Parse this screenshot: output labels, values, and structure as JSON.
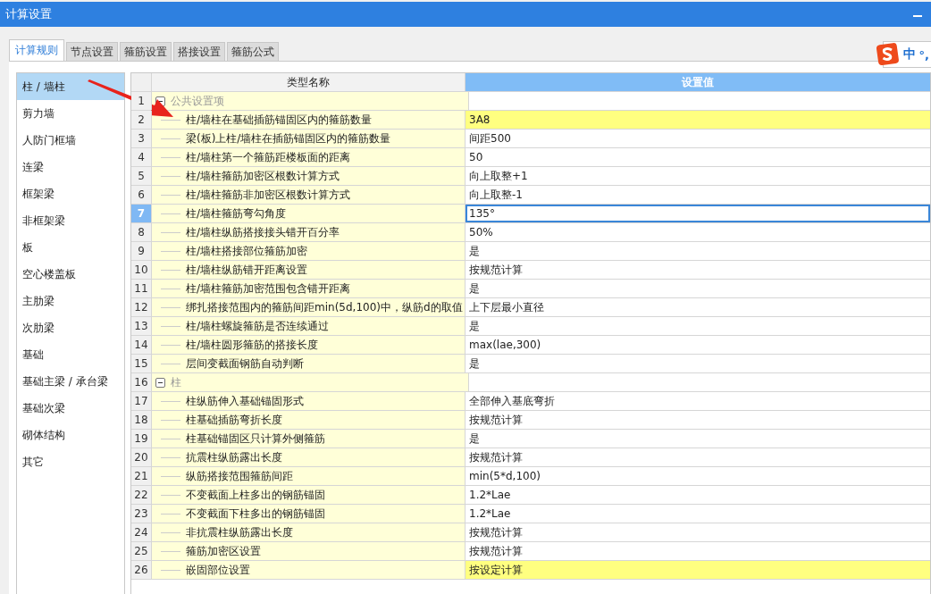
{
  "window": {
    "title": "计算设置"
  },
  "ime": {
    "mode": "中",
    "punctuation": "°,"
  },
  "tabs": [
    {
      "label": "计算规则",
      "selected": true
    },
    {
      "label": "节点设置",
      "selected": false
    },
    {
      "label": "箍筋设置",
      "selected": false
    },
    {
      "label": "搭接设置",
      "selected": false
    },
    {
      "label": "箍筋公式",
      "selected": false
    }
  ],
  "sidebar": {
    "items": [
      {
        "label": "柱 / 墙柱",
        "selected": true
      },
      {
        "label": "剪力墙",
        "selected": false
      },
      {
        "label": "人防门框墙",
        "selected": false
      },
      {
        "label": "连梁",
        "selected": false
      },
      {
        "label": "框架梁",
        "selected": false
      },
      {
        "label": "非框架梁",
        "selected": false
      },
      {
        "label": "板",
        "selected": false
      },
      {
        "label": "空心楼盖板",
        "selected": false
      },
      {
        "label": "主肋梁",
        "selected": false
      },
      {
        "label": "次肋梁",
        "selected": false
      },
      {
        "label": "基础",
        "selected": false
      },
      {
        "label": "基础主梁 / 承台梁",
        "selected": false
      },
      {
        "label": "基础次梁",
        "selected": false
      },
      {
        "label": "砌体结构",
        "selected": false
      },
      {
        "label": "其它",
        "selected": false
      }
    ]
  },
  "table": {
    "columns": [
      "类型名称",
      "设置值"
    ],
    "rows": [
      {
        "kind": "group",
        "number": "1",
        "name": "公共设置项",
        "expanded": true,
        "selected": false
      },
      {
        "kind": "setting",
        "number": "2",
        "name": "柱/墙柱在基础插筋锚固区内的箍筋数量",
        "value": "3A8",
        "highlighted": true,
        "selected": false
      },
      {
        "kind": "setting",
        "number": "3",
        "name": "梁(板)上柱/墙柱在插筋锚固区内的箍筋数量",
        "value": "间距500",
        "highlighted": false,
        "selected": false
      },
      {
        "kind": "setting",
        "number": "4",
        "name": "柱/墙柱第一个箍筋距楼板面的距离",
        "value": "50",
        "highlighted": false,
        "selected": false
      },
      {
        "kind": "setting",
        "number": "5",
        "name": "柱/墙柱箍筋加密区根数计算方式",
        "value": "向上取整+1",
        "highlighted": false,
        "selected": false
      },
      {
        "kind": "setting",
        "number": "6",
        "name": "柱/墙柱箍筋非加密区根数计算方式",
        "value": "向上取整-1",
        "highlighted": false,
        "selected": false
      },
      {
        "kind": "setting",
        "number": "7",
        "name": "柱/墙柱箍筋弯勾角度",
        "value": "135°",
        "highlighted": false,
        "selected": true
      },
      {
        "kind": "setting",
        "number": "8",
        "name": "柱/墙柱纵筋搭接接头错开百分率",
        "value": "50%",
        "highlighted": false,
        "selected": false
      },
      {
        "kind": "setting",
        "number": "9",
        "name": "柱/墙柱搭接部位箍筋加密",
        "value": "是",
        "highlighted": false,
        "selected": false
      },
      {
        "kind": "setting",
        "number": "10",
        "name": "柱/墙柱纵筋错开距离设置",
        "value": "按规范计算",
        "highlighted": false,
        "selected": false
      },
      {
        "kind": "setting",
        "number": "11",
        "name": "柱/墙柱箍筋加密范围包含错开距离",
        "value": "是",
        "highlighted": false,
        "selected": false
      },
      {
        "kind": "setting",
        "number": "12",
        "name": "绑扎搭接范围内的箍筋间距min(5d,100)中，纵筋d的取值",
        "value": "上下层最小直径",
        "highlighted": false,
        "selected": false
      },
      {
        "kind": "setting",
        "number": "13",
        "name": "柱/墙柱螺旋箍筋是否连续通过",
        "value": "是",
        "highlighted": false,
        "selected": false
      },
      {
        "kind": "setting",
        "number": "14",
        "name": "柱/墙柱圆形箍筋的搭接长度",
        "value": "max(lae,300)",
        "highlighted": false,
        "selected": false
      },
      {
        "kind": "setting",
        "number": "15",
        "name": "层间变截面钢筋自动判断",
        "value": "是",
        "highlighted": false,
        "selected": false
      },
      {
        "kind": "group",
        "number": "16",
        "name": "柱",
        "expanded": true,
        "selected": false
      },
      {
        "kind": "setting",
        "number": "17",
        "name": "柱纵筋伸入基础锚固形式",
        "value": "全部伸入基底弯折",
        "highlighted": false,
        "selected": false
      },
      {
        "kind": "setting",
        "number": "18",
        "name": "柱基础插筋弯折长度",
        "value": "按规范计算",
        "highlighted": false,
        "selected": false
      },
      {
        "kind": "setting",
        "number": "19",
        "name": "柱基础锚固区只计算外侧箍筋",
        "value": "是",
        "highlighted": false,
        "selected": false
      },
      {
        "kind": "setting",
        "number": "20",
        "name": "抗震柱纵筋露出长度",
        "value": "按规范计算",
        "highlighted": false,
        "selected": false
      },
      {
        "kind": "setting",
        "number": "21",
        "name": "纵筋搭接范围箍筋间距",
        "value": "min(5*d,100)",
        "highlighted": false,
        "selected": false
      },
      {
        "kind": "setting",
        "number": "22",
        "name": "不变截面上柱多出的钢筋锚固",
        "value": "1.2*Lae",
        "highlighted": false,
        "selected": false
      },
      {
        "kind": "setting",
        "number": "23",
        "name": "不变截面下柱多出的钢筋锚固",
        "value": "1.2*Lae",
        "highlighted": false,
        "selected": false
      },
      {
        "kind": "setting",
        "number": "24",
        "name": "非抗震柱纵筋露出长度",
        "value": "按规范计算",
        "highlighted": false,
        "selected": false
      },
      {
        "kind": "setting",
        "number": "25",
        "name": "箍筋加密区设置",
        "value": "按规范计算",
        "highlighted": false,
        "selected": false
      },
      {
        "kind": "setting",
        "number": "26",
        "name": "嵌固部位设置",
        "value": "按设定计算",
        "highlighted": true,
        "selected": false
      }
    ]
  }
}
